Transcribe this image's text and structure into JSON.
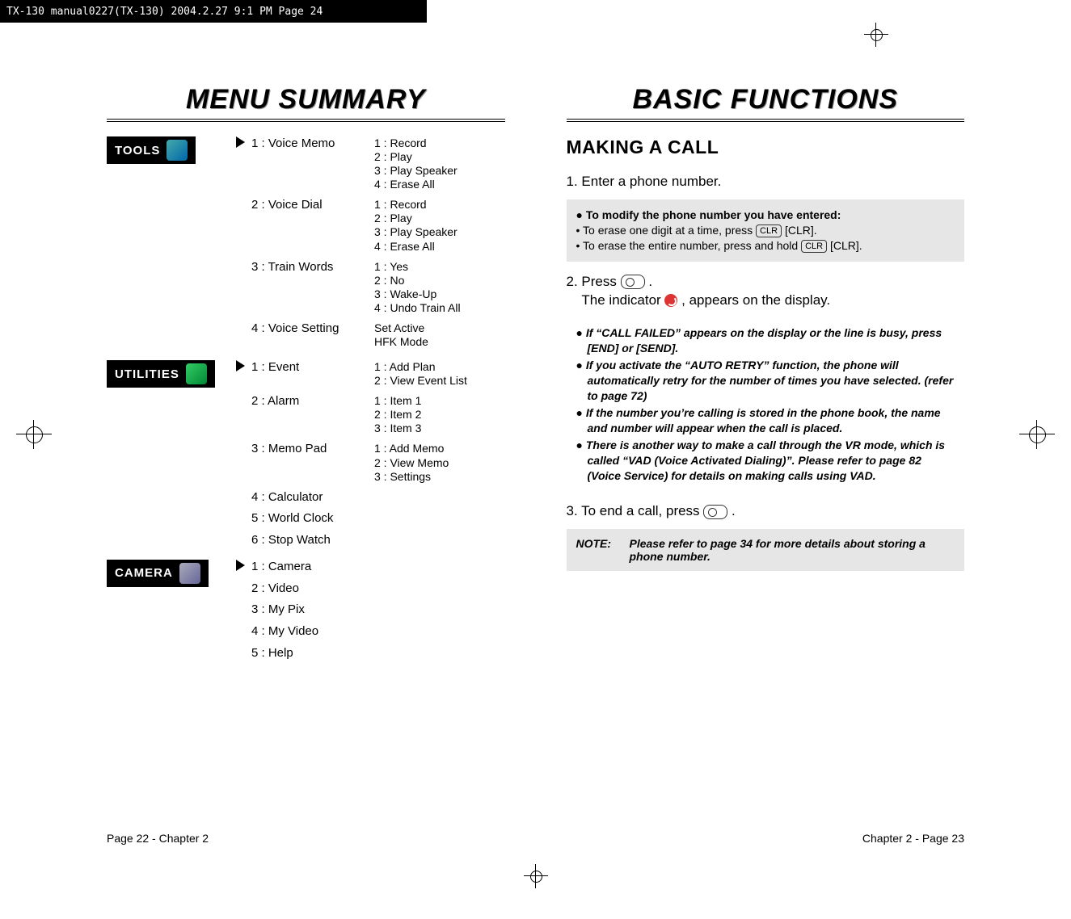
{
  "header": "TX-130 manual0227(TX-130)  2004.2.27  9:1 PM  Page 24",
  "left": {
    "title": "MENU SUMMARY",
    "blocks": [
      {
        "badge": "TOOLS",
        "items": [
          {
            "l": "1 : Voice Memo",
            "r": "1 : Record\n2 : Play\n3 : Play Speaker\n4 : Erase All"
          },
          {
            "l": "2 : Voice Dial",
            "r": "1 : Record\n2 : Play\n3 : Play Speaker\n4 : Erase All"
          },
          {
            "l": "3 : Train Words",
            "r": "1 : Yes\n2 : No\n3 : Wake-Up\n4 : Undo Train All"
          },
          {
            "l": "4 : Voice Setting",
            "r": "Set Active\nHFK Mode"
          }
        ]
      },
      {
        "badge": "UTILITIES",
        "items": [
          {
            "l": "1 : Event",
            "r": "1 : Add Plan\n2 : View Event List"
          },
          {
            "l": "2 : Alarm",
            "r": "1 : Item 1\n2 : Item 2\n3 : Item 3"
          },
          {
            "l": "3 : Memo Pad",
            "r": "1 : Add Memo\n2 : View Memo\n3 : Settings"
          },
          {
            "l": "4 : Calculator",
            "r": ""
          },
          {
            "l": "5 : World Clock",
            "r": ""
          },
          {
            "l": "6 : Stop Watch",
            "r": ""
          }
        ]
      },
      {
        "badge": "CAMERA",
        "items": [
          {
            "l": "1 : Camera",
            "r": ""
          },
          {
            "l": "2 : Video",
            "r": ""
          },
          {
            "l": "3 : My Pix",
            "r": ""
          },
          {
            "l": "4 : My Video",
            "r": ""
          },
          {
            "l": "5 : Help",
            "r": ""
          }
        ]
      }
    ],
    "footer": "Page 22 - Chapter 2"
  },
  "right": {
    "title": "BASIC FUNCTIONS",
    "section": "MAKING A CALL",
    "step1": "1. Enter a phone number.",
    "box1_h": "● To modify the phone number you have entered:",
    "box1_a": "•  To erase one digit at a time, press ",
    "box1_a2": " [CLR].",
    "box1_b": "•  To erase the entire number, press and hold ",
    "box1_b2": " [CLR].",
    "step2a": "2. Press ",
    "step2b": ".",
    "step2c": "The indicator ",
    "step2d": " , appears on the display.",
    "bullets": [
      "If “CALL FAILED” appears on the display or the line is busy, press [END] or [SEND].",
      "If you activate the “AUTO RETRY” function, the phone will automatically retry for the number of times you have selected. (refer to page 72)",
      "If the number you’re calling is stored in the phone book, the name and number will appear when the call is placed.",
      "There is another way to make a call through the VR mode, which is called “VAD (Voice Activated Dialing)”. Please refer to page 82 (Voice Service) for details on making calls using VAD."
    ],
    "step3a": "3. To end a call, press ",
    "step3b": ".",
    "note_label": "NOTE:",
    "note_text": "Please refer to page 34 for more details about storing a phone number.",
    "footer": "Chapter 2 - Page 23"
  },
  "clr": "CLR"
}
